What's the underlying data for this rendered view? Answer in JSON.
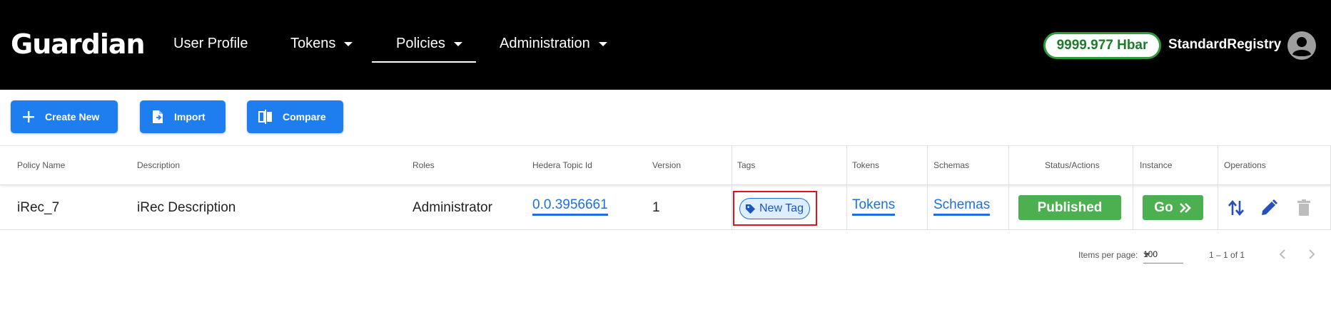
{
  "header": {
    "logo": "Guardian",
    "nav": [
      {
        "label": "User Profile",
        "has_caret": false
      },
      {
        "label": "Tokens",
        "has_caret": true
      },
      {
        "label": "Policies",
        "has_caret": true,
        "active": true
      },
      {
        "label": "Administration",
        "has_caret": true
      }
    ],
    "balance": "9999.977 Hbar",
    "username": "StandardRegistry",
    "avatar_icon": "account-circle-icon"
  },
  "toolbar": {
    "create_label": "Create New",
    "import_label": "Import",
    "compare_label": "Compare"
  },
  "table": {
    "headers": [
      "Policy Name",
      "Description",
      "Roles",
      "Hedera Topic Id",
      "Version",
      "Tags",
      "Tokens",
      "Schemas",
      "Status/Actions",
      "Instance",
      "Operations"
    ],
    "rows": [
      {
        "name": "iRec_7",
        "description": "iRec Description",
        "roles": "Administrator",
        "topic_id": "0.0.3956661",
        "version": "1",
        "tag": "New Tag",
        "tokens": "Tokens",
        "schemas": "Schemas",
        "status": "Published",
        "instance": "Go"
      }
    ]
  },
  "pager": {
    "items_per_page_label": "Items per page:",
    "items_per_page": "100",
    "range": "1 – 1 of 1"
  },
  "colors": {
    "header_bg": "#000000",
    "primary": "#1e7ef0",
    "success": "#4caf50",
    "link": "#1e6fe0",
    "highlight": "#e0141e"
  }
}
